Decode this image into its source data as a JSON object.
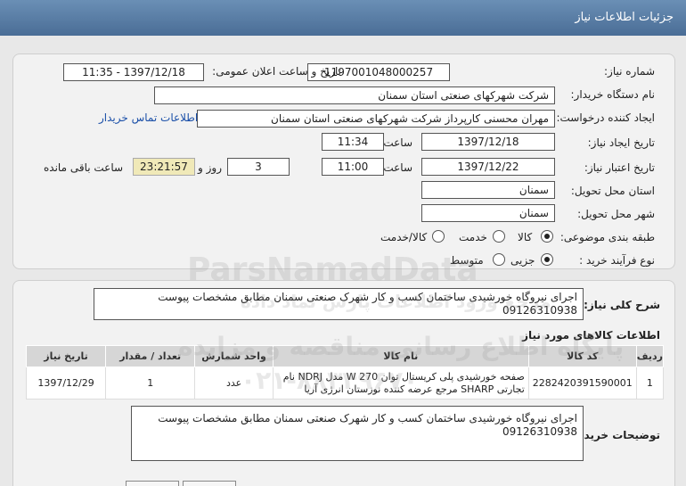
{
  "header": {
    "title": "جزئیات اطلاعات نیاز"
  },
  "form": {
    "need_number_label": "شماره نیاز:",
    "need_number": "1197001048000257",
    "announce_label": "تاریخ و ساعت اعلان عمومی:",
    "announce_value": "1397/12/18 - 11:35",
    "buyer_org_label": "نام دستگاه خریدار:",
    "buyer_org": "شرکت شهرکهای صنعتی استان سمنان",
    "creator_label": "ایجاد کننده درخواست:",
    "creator": "مهران محسنی کارپرداز شرکت شهرکهای صنعتی استان سمنان",
    "contact_link": "اطلاعات تماس خریدار",
    "created_date_label": "تاریخ ایجاد نیاز:",
    "created_date": "1397/12/18",
    "time_label": "ساعت",
    "created_time": "11:34",
    "validity_label": "تاریخ اعتبار نیاز:",
    "validity_date": "1397/12/22",
    "validity_time": "11:00",
    "days_label": "روز و",
    "days": "3",
    "remaining_time": "23:21:57",
    "remaining_label": "ساعت باقی مانده",
    "province_label": "استان محل تحویل:",
    "province": "سمنان",
    "city_label": "شهر محل تحویل:",
    "city": "سمنان",
    "category_label": "طبقه بندی موضوعی:",
    "category_options": [
      "کالا",
      "خدمت",
      "کالا/خدمت"
    ],
    "process_label": "نوع فرآیند خرید :",
    "process_options": [
      "جزیی",
      "متوسط"
    ]
  },
  "summary": {
    "label": "شرح کلی نیاز:",
    "line1": "اجرای نیروگاه خورشیدی ساختمان کسب و کار شهرک صنعتی سمنان مطابق مشخصات پیوست",
    "line2": "09126310938"
  },
  "goods_section": {
    "title": "اطلاعات کالاهای مورد نیاز",
    "columns": [
      "ردیف",
      "کد کالا",
      "نام کالا",
      "واحد شمارش",
      "تعداد / مقدار",
      "تاریخ نیاز"
    ],
    "rows": [
      {
        "row": "1",
        "code": "2282420391590001",
        "name_line1": "صفحه خورشیدی پلی کریستال توان W 270 مدل NDRJ نام",
        "name_line2": "تجارتی SHARP مرجع عرضه کننده نوزستان انرژی آریا",
        "unit": "عدد",
        "qty": "1",
        "date": "1397/12/29"
      }
    ]
  },
  "buyer_notes": {
    "label": "توضیحات خریدار:",
    "line1": "اجرای نیروگاه خورشیدی ساختمان کسب و کار شهرک صنعتی سمنان مطابق مشخصات پیوست",
    "line2": "09126310938"
  },
  "watermark": {
    "brand": "ParsNamadData",
    "line1": "مرجع ورود اطلاعات پارس نماد داده",
    "line2": "پایگاه اطلاع رسانی مناقصه و مزایده",
    "phone": "۰۲۱-۸۸۳۴۹۶۷۰"
  },
  "colors": {
    "header_bg": "#5a7fa8",
    "link": "#1a4fa8",
    "remaining_bg": "#f0e9b8"
  }
}
